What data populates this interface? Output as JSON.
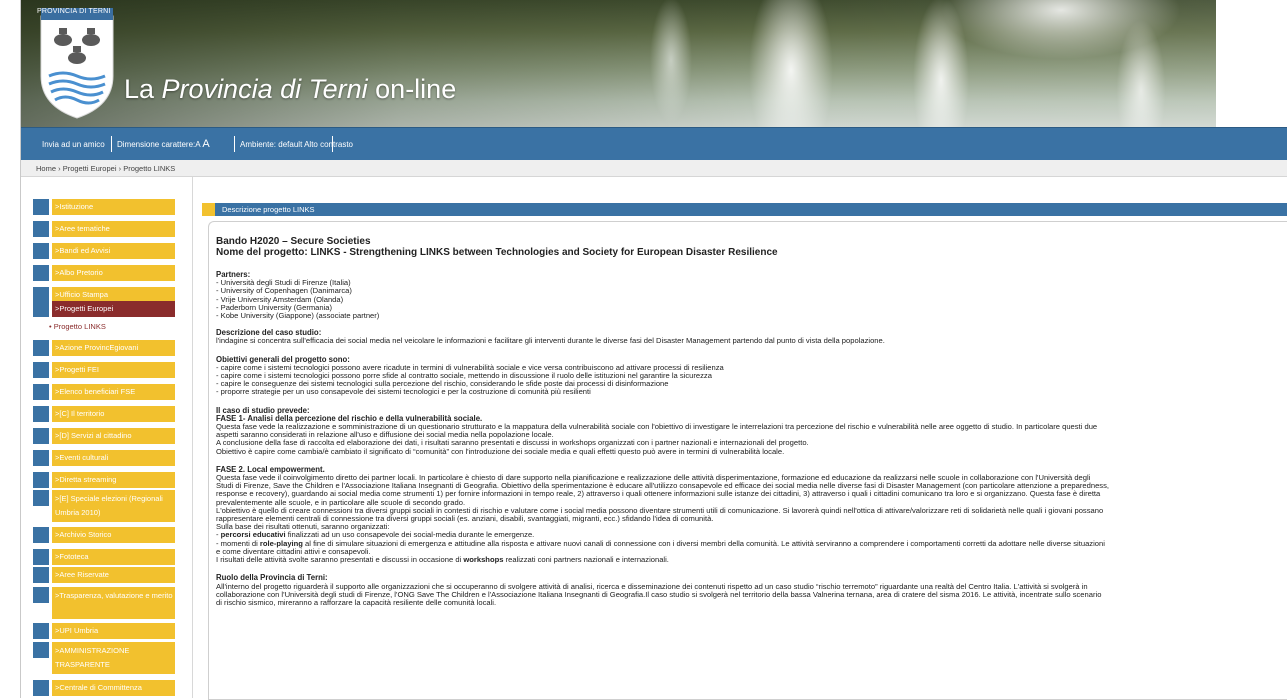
{
  "header": {
    "crest_label": "PROVINCIA DI TERNI",
    "title_prefix": "La ",
    "title_italic": "Provincia di Terni",
    "title_suffix": " on-line"
  },
  "toolbar": {
    "send_friend": "Invia ad un amico",
    "font_size_label": "Dimensione carattere:",
    "font_small": "A",
    "font_big": "A",
    "ambient_label": "Ambiente:",
    "ambient_default": "default",
    "ambient_contrast": "Alto contrasto"
  },
  "breadcrumb": {
    "home": "Home",
    "sep": "›",
    "level1": "Progetti Europei",
    "level2": "Progetto LINKS"
  },
  "sidebar": {
    "items": [
      {
        "label": ">Istituzione"
      },
      {
        "label": ">Aree tematiche"
      },
      {
        "label": ">Bandi ed Avvisi"
      },
      {
        "label": ">Albo Pretorio"
      },
      {
        "label": ">Ufficio Stampa"
      },
      {
        "label": ">Progetti Europei"
      },
      {
        "label": ">Azione ProvincEgiovani"
      },
      {
        "label": ">Progetti FEI"
      },
      {
        "label": ">Elenco beneficiari FSE"
      },
      {
        "label": ">[C] Il territorio"
      },
      {
        "label": ">[D] Servizi al cittadino"
      },
      {
        "label": ">Eventi culturali"
      },
      {
        "label": ">Diretta streaming"
      },
      {
        "label": ">[E] Speciale elezioni (Regionali Umbria 2010)"
      },
      {
        "label": ">Archivio Storico"
      },
      {
        "label": ">Fototeca"
      },
      {
        "label": ">Aree Riservate"
      },
      {
        "label": ">Trasparenza, valutazione e merito"
      },
      {
        "label": ">UPI Umbria"
      },
      {
        "label": ">AMMINISTRAZIONE TRASPARENTE"
      },
      {
        "label": ">Centrale di Committenza"
      }
    ],
    "subitem": "• Progetto LINKS"
  },
  "main": {
    "tab_label": "Descrizione progetto LINKS",
    "title_line1": "Bando H2020 – Secure Societies",
    "title_line2": "Nome del progetto: LINKS - Strengthening LINKS between Technologies and Society for European Disaster Resilience",
    "partners_title": "Partners:",
    "partners": [
      "- Università degli Studi di Firenze (Italia)",
      "- University of Copenhagen (Danimarca)",
      "- Vrije University Amsterdam (Olanda)",
      "- Paderborn University (Germania)",
      "- Kobe University (Giappone) (associate partner)"
    ],
    "case_desc_title": "Descrizione del caso studio:",
    "case_desc_text": "l'indagine si concentra sull'efficacia dei social media nel veicolare le informazioni e facilitare gli interventi durante le diverse fasi del Disaster Management partendo dal punto di vista della popolazione.",
    "objectives_title": "Obiettivi generali del progetto sono:",
    "objectives": [
      "- capire come i sistemi tecnologici possono avere ricadute in termini di vulnerabilità sociale e vice versa contribuiscono ad attivare processi di resilienza",
      "- capire come i sistemi tecnologici possono porre sfide al contratto sociale, mettendo in discussione il ruolo delle istituzioni nel garantire la sicurezza",
      "- capire le conseguenze dei sistemi tecnologici sulla percezione del rischio, considerando le sfide poste dai processi di disinformazione",
      "- proporre strategie per un uso consapevole dei sistemi tecnologici e per la costruzione di comunità più resilienti"
    ],
    "case_study_title": "Il caso di studio prevede:",
    "phase1_title": "FASE 1- Analisi della percezione del rischio e della vulnerabilità sociale.",
    "phase1_lines": [
      "Questa fase vede la realizzazione e somministrazione di un questionario strutturato e la mappatura della vulnerabilità sociale con l'obiettivo di investigare le interrelazioni tra percezione del rischio e vulnerabilità nelle aree oggetto di studio. In particolare questi due",
      "aspetti saranno considerati in relazione all'uso e diffusione dei social media nella popolazione locale.",
      "A conclusione della fase di raccolta ed elaborazione dei dati, i risultati saranno presentati e discussi in workshops organizzati con i partner nazionali e internazionali del progetto.",
      "Obiettivo è capire come cambia/è cambiato il significato di “comunità” con l'introduzione dei sociale media e quali effetti questo può avere in termini di vulnerabilità locale."
    ],
    "phase2_title": "FASE 2. Local empowerment.",
    "phase2_lines": [
      "Questa fase vede il coinvolgimento diretto dei partner locali. In particolare è chiesto di dare supporto nella pianificazione e realizzazione delle attività disperimentazione, formazione ed educazione da realizzarsi nelle scuole in collaborazione con l'Università degli",
      "Studi di Firenze, Save the Children e l'Associazione Italiana Insegnanti di Geografia. Obiettivo della sperimentazione è educare all'utilizzo consapevole ed efficace dei social media nelle diverse fasi di Disaster Management (con particolare attenzione a preparedness,",
      "response e recovery), guardando ai social media come strumenti 1) per fornire informazioni in tempo reale, 2) attraverso i quali ottenere informazioni sulle istanze dei cittadini, 3) attraverso i quali i cittadini comunicano tra loro e si organizzano. Questa fase è diretta",
      "prevalentemente alle scuole, e in particolare alle scuole di secondo grado.",
      "L'obiettivo è quello di creare connessioni tra diversi gruppi sociali in contesti di rischio e valutare come i social media possono diventare strumenti utili di comunicazione. Si lavorerà quindi nell'ottica di attivare/valorizzare reti di solidarietà nelle quali i giovani possano",
      "rappresentare elementi centrali di connessione tra diversi gruppi sociali (es. anziani, disabili, svantaggiati, migranti, ecc.) sfidando l'idea di comunità.",
      "Sulla base dei risultati ottenuti, saranno organizzati:"
    ],
    "phase2_bullet1_bold": "percorsi educativi",
    "phase2_bullet1_rest": " finalizzati ad un uso consapevole dei social-media durante le emergenze.",
    "phase2_bullet2_pre": "- momenti di ",
    "phase2_bullet2_bold": "role-playing",
    "phase2_bullet2_rest": " al fine di simulare situazioni di emergenza e attitudine alla risposta e attivare nuovi canali di connessione con i diversi membri della comunità. Le attività serviranno a comprendere i comportamenti corretti da adottare nelle diverse situazioni",
    "phase2_bullet2_cont": "e come diventare cittadini attivi e consapevoli.",
    "phase2_final_pre": "I risultati delle attività svolte saranno presentati e discussi in occasione di ",
    "phase2_final_bold": "workshops",
    "phase2_final_rest": " realizzati coni partners nazionali e internazionali.",
    "role_title": "Ruolo della Provincia di Terni:",
    "role_lines": [
      "All'interno del progetto riguarderà il supporto alle organizzazioni che si occuperanno di svolgere attività di analisi, ricerca e disseminazione dei contenuti rispetto ad un caso studio “rischio terremoto” riguardante una realtà del Centro Italia. L'attività si svolgerà in",
      "collaborazione con l'Università degli studi di Firenze, l'ONG Save The Children e l'Associazione Italiana Insegnanti di Geografia.Il caso studio si svolgerà nel territorio della bassa Valnerina ternana, area di cratere del sisma 2016. Le attività, incentrate sullo scenario",
      "di rischio sismico, mireranno a rafforzare la capacità resiliente delle comunità locali."
    ]
  },
  "colors": {
    "blue": "#3a72a4",
    "yellow": "#f2c12e",
    "active": "#8a2c2c"
  }
}
